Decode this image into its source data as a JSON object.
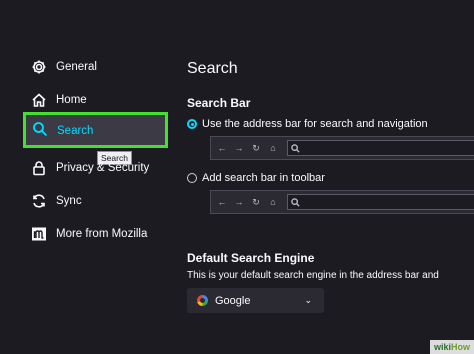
{
  "sidebar": {
    "items": [
      {
        "label": "General",
        "icon": "gear-icon"
      },
      {
        "label": "Home",
        "icon": "home-icon"
      },
      {
        "label": "Search",
        "icon": "search-icon",
        "selected": true
      },
      {
        "label": "Privacy & Security",
        "icon": "lock-icon"
      },
      {
        "label": "Sync",
        "icon": "sync-icon"
      },
      {
        "label": "More from Mozilla",
        "icon": "mozilla-icon"
      }
    ],
    "tooltip": "Search"
  },
  "main": {
    "title": "Search",
    "search_bar": {
      "heading": "Search Bar",
      "option_address_bar": "Use the address bar for search and navigation",
      "option_toolbar": "Add search bar in toolbar",
      "selected": "address_bar"
    },
    "default_engine": {
      "heading": "Default Search Engine",
      "description": "This is your default search engine in the address bar and",
      "selected": "Google"
    }
  },
  "watermark": {
    "part1": "wiki",
    "part2": "How"
  },
  "colors": {
    "background": "#1c1b22",
    "accent": "#00ddff",
    "highlight_border": "#43e12d",
    "selected_bg": "#3b3a45"
  }
}
